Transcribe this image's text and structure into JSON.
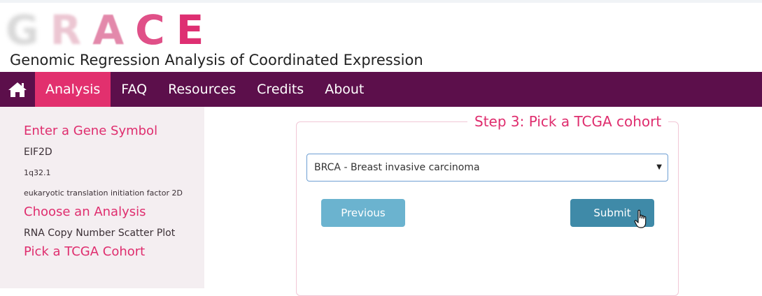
{
  "logo": {
    "letters": [
      "G",
      "R",
      "A",
      "C",
      "E"
    ]
  },
  "header": {
    "subtitle": "Genomic Regression Analysis of Coordinated Expression"
  },
  "nav": {
    "home_icon": "home-icon",
    "items": [
      {
        "label": "Analysis",
        "active": true
      },
      {
        "label": "FAQ"
      },
      {
        "label": "Resources"
      },
      {
        "label": "Credits"
      },
      {
        "label": "About"
      }
    ]
  },
  "sidebar": {
    "gene_heading": "Enter a Gene Symbol",
    "gene_symbol": "EIF2D",
    "gene_location": "1q32.1",
    "gene_description": "eukaryotic translation initiation factor 2D",
    "analysis_heading": "Choose an Analysis",
    "analysis_value": "RNA Copy Number Scatter Plot",
    "cohort_heading": "Pick a TCGA Cohort"
  },
  "step": {
    "legend": "Step 3: Pick a TCGA cohort",
    "select_value": "BRCA - Breast invasive carcinoma",
    "previous_label": "Previous",
    "submit_label": "Submit"
  },
  "colors": {
    "brand_pink": "#df2d6e",
    "nav_bg": "#5c0f4b",
    "button_blue": "#6bb3cf",
    "button_dark": "#3f8aa8"
  }
}
